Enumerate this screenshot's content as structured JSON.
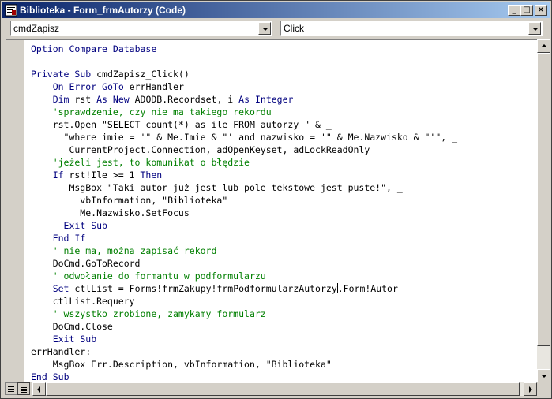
{
  "window": {
    "title": "Biblioteka - Form_frmAutorzy (Code)",
    "controls": {
      "minimize": "_",
      "maximize": "□",
      "close": "×"
    }
  },
  "object_combo": {
    "value": "cmdZapisz"
  },
  "procedure_combo": {
    "value": "Click"
  },
  "code_lines": [
    "Option Compare Database",
    "",
    "Private Sub cmdZapisz_Click()",
    "    On Error GoTo errHandler",
    "    Dim rst As New ADODB.Recordset, i As Integer",
    "    'sprawdzenie, czy nie ma takiego rekordu",
    "    rst.Open \"SELECT count(*) as ile FROM autorzy \" & _",
    "      \"where imie = '\" & Me.Imie & \"' and nazwisko = '\" & Me.Nazwisko & \"'\", _",
    "       CurrentProject.Connection, adOpenKeyset, adLockReadOnly",
    "    'jeżeli jest, to komunikat o błędzie",
    "    If rst!Ile >= 1 Then",
    "       MsgBox \"Taki autor już jest lub pole tekstowe jest puste!\", _",
    "         vbInformation, \"Biblioteka\"",
    "         Me.Nazwisko.SetFocus",
    "      Exit Sub",
    "    End If",
    "    ' nie ma, można zapisać rekord",
    "    DoCmd.GoToRecord",
    "    ' odwołanie do formantu w podformularzu",
    "    Set ctlList = Forms!frmZakupy!frmPodformularzAutorzy.Form!Autor",
    "    ctlList.Requery",
    "    ' wszystko zrobione, zamykamy formularz",
    "    DoCmd.Close",
    "    Exit Sub",
    "errHandler:",
    "    MsgBox Err.Description, vbInformation, \"Biblioteka\"",
    "End Sub"
  ],
  "colors": {
    "keyword": "#00007f",
    "comment": "#007f00",
    "text": "#000000",
    "title_start": "#0a246a",
    "title_end": "#a6caf0"
  }
}
